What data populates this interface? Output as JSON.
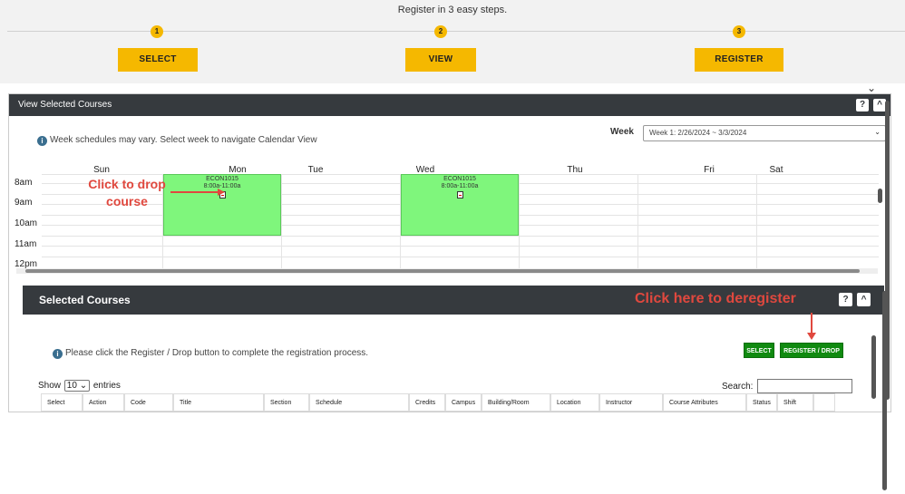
{
  "steps": {
    "caption": "Register in 3 easy steps.",
    "items": [
      {
        "number": "1",
        "label": "SELECT"
      },
      {
        "number": "2",
        "label": "VIEW"
      },
      {
        "number": "3",
        "label": "REGISTER"
      }
    ]
  },
  "view_panel": {
    "title": "View Selected Courses",
    "help_icon": "?",
    "collapse_icon": "chevron-up-icon",
    "info_text": "Week schedules may vary. Select week to navigate Calendar View",
    "week_label": "Week",
    "week_value": "Week 1: 2/26/2024 ~ 3/3/2024"
  },
  "calendar": {
    "days": [
      "Sun",
      "Mon",
      "Tue",
      "Wed",
      "Thu",
      "Fri",
      "Sat"
    ],
    "hours": [
      "8am",
      "9am",
      "10am",
      "11am",
      "12pm"
    ],
    "events": [
      {
        "day": "Mon",
        "code": "ECON1015",
        "time": "8:00a-11:00a"
      },
      {
        "day": "Wed",
        "code": "ECON1015",
        "time": "8:00a-11:00a"
      }
    ]
  },
  "annotations": {
    "drop_line1": "Click to drop",
    "drop_line2": "course",
    "deregister": "Click here to deregister"
  },
  "selected_panel": {
    "title": "Selected Courses",
    "help_icon": "?",
    "info_text": "Please click the Register / Drop button to complete the registration process.",
    "select_button": "SELECT",
    "register_drop_button": "REGISTER / DROP",
    "show_label": "Show",
    "entries_value": "10",
    "entries_label": "entries",
    "search_label": "Search:",
    "columns": [
      "Select",
      "Action",
      "Code",
      "Title",
      "Section",
      "Schedule",
      "Credits",
      "Campus",
      "Building/Room",
      "Location",
      "Instructor",
      "Course Attributes",
      "Status",
      "Shift"
    ]
  },
  "colors": {
    "accent": "#f5b800",
    "header": "#363a3e",
    "event": "#7ff67c",
    "action_green": "#108a10",
    "annotation": "#e0483e"
  }
}
